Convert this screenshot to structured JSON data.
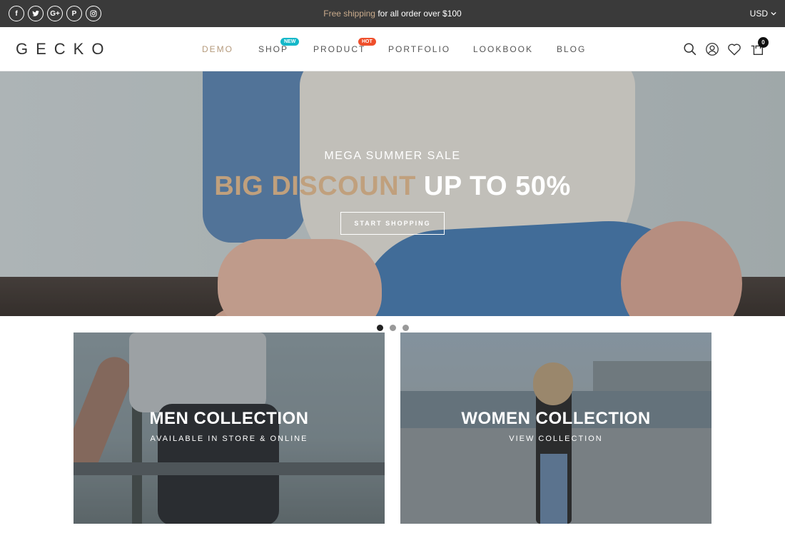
{
  "topbar": {
    "socials": [
      {
        "icon": "facebook-icon",
        "glyph": "f"
      },
      {
        "icon": "twitter-icon",
        "glyph": ""
      },
      {
        "icon": "google-plus-icon",
        "glyph": "G+"
      },
      {
        "icon": "pinterest-icon",
        "glyph": "P"
      },
      {
        "icon": "instagram-icon",
        "glyph": ""
      }
    ],
    "promo_accent": "Free shipping",
    "promo_rest": " for all order over $100",
    "currency": "USD"
  },
  "header": {
    "logo": "GECKO",
    "nav": [
      {
        "label": "DEMO",
        "active": true
      },
      {
        "label": "SHOP",
        "badge": "NEW"
      },
      {
        "label": "PRODUCT",
        "badge": "HOT"
      },
      {
        "label": "PORTFOLIO"
      },
      {
        "label": "LOOKBOOK"
      },
      {
        "label": "BLOG"
      }
    ],
    "cart_count": "0"
  },
  "hero": {
    "subtitle": "MEGA SUMMER SALE",
    "title_accent": "BIG DISCOUNT",
    "title_main": " UP TO 50%",
    "button": "START SHOPPING",
    "slides": 3,
    "active_slide": 1
  },
  "collections": [
    {
      "title": "MEN COLLECTION",
      "subtitle": "AVAILABLE IN STORE & ONLINE"
    },
    {
      "title": "WOMEN COLLECTION",
      "subtitle": "VIEW COLLECTION"
    }
  ],
  "colors": {
    "accent": "#c0a07d",
    "topbar_bg": "#3a3a3a",
    "badge_new": "#14b8c9",
    "badge_hot": "#ef4f2b"
  }
}
